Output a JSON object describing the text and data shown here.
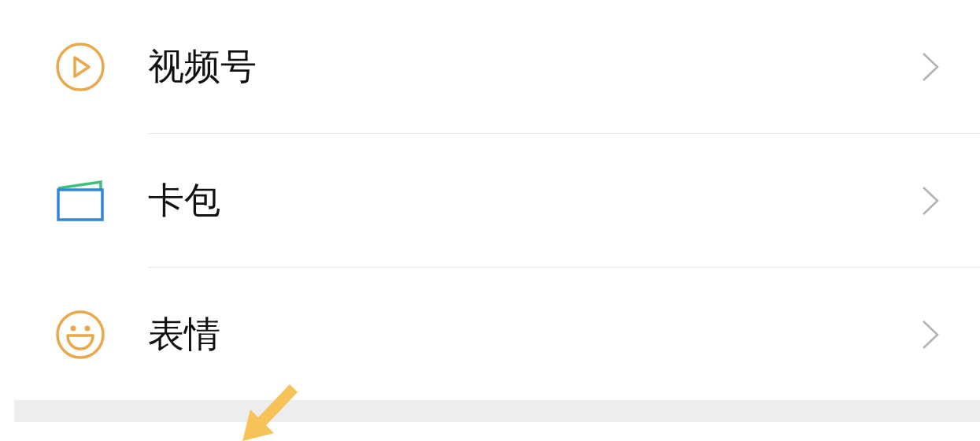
{
  "items": [
    {
      "kind": "play",
      "label": "视频号"
    },
    {
      "kind": "card",
      "label": "卡包"
    },
    {
      "kind": "smile",
      "label": "表情"
    }
  ]
}
